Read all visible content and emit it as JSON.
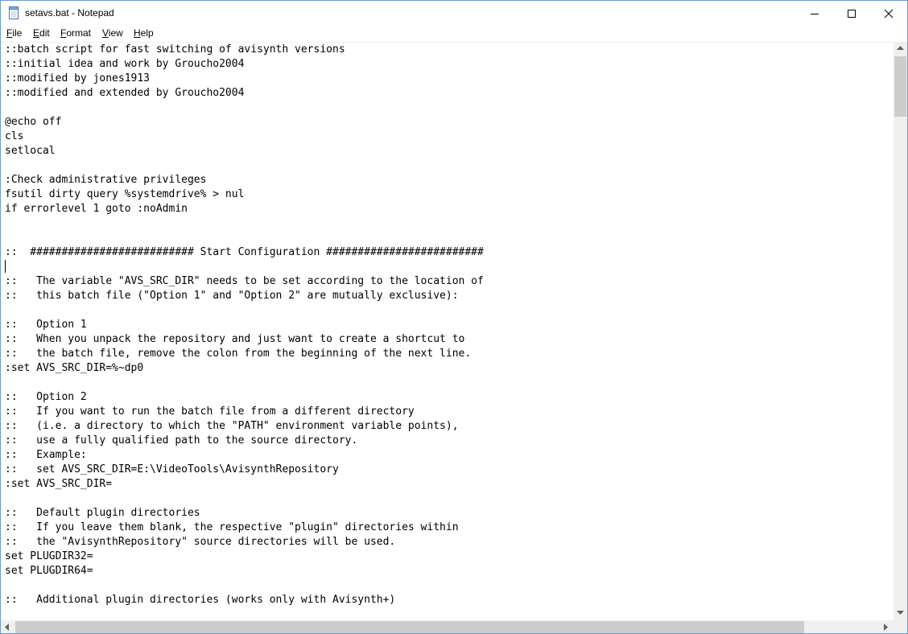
{
  "window": {
    "title": "setavs.bat - Notepad",
    "app_icon": "notepad-icon",
    "controls": [
      "minimize-icon",
      "maximize-icon",
      "close-icon"
    ]
  },
  "menu": {
    "file": {
      "accel": "F",
      "rest": "ile"
    },
    "edit": {
      "accel": "E",
      "rest": "dit"
    },
    "format": {
      "accel": "F",
      "pre": "",
      "rest": "ormat",
      "label": "Format"
    },
    "view": {
      "accel": "V",
      "rest": "iew"
    },
    "help": {
      "accel": "H",
      "rest": "elp"
    }
  },
  "editor": {
    "text": "::batch script for fast switching of avisynth versions\n::initial idea and work by Groucho2004\n::modified by jones1913\n::modified and extended by Groucho2004\n\n@echo off\ncls\nsetlocal\n\n:Check administrative privileges\nfsutil dirty query %systemdrive% > nul\nif errorlevel 1 goto :noAdmin\n\n\n::  ########################## Start Configuration #########################\n\n::   The variable \"AVS_SRC_DIR\" needs to be set according to the location of\n::   this batch file (\"Option 1\" and \"Option 2\" are mutually exclusive):\n\n::   Option 1\n::   When you unpack the repository and just want to create a shortcut to\n::   the batch file, remove the colon from the beginning of the next line.\n:set AVS_SRC_DIR=%~dp0\n\n::   Option 2\n::   If you want to run the batch file from a different directory\n::   (i.e. a directory to which the \"PATH\" environment variable points),\n::   use a fully qualified path to the source directory.\n::   Example:\n::   set AVS_SRC_DIR=E:\\VideoTools\\AvisynthRepository\n:set AVS_SRC_DIR=\n\n::   Default plugin directories\n::   If you leave them blank, the respective \"plugin\" directories within\n::   the \"AvisynthRepository\" source directories will be used.\nset PLUGDIR32=\nset PLUGDIR64=\n\n::   Additional plugin directories (works only with Avisynth+)"
  }
}
